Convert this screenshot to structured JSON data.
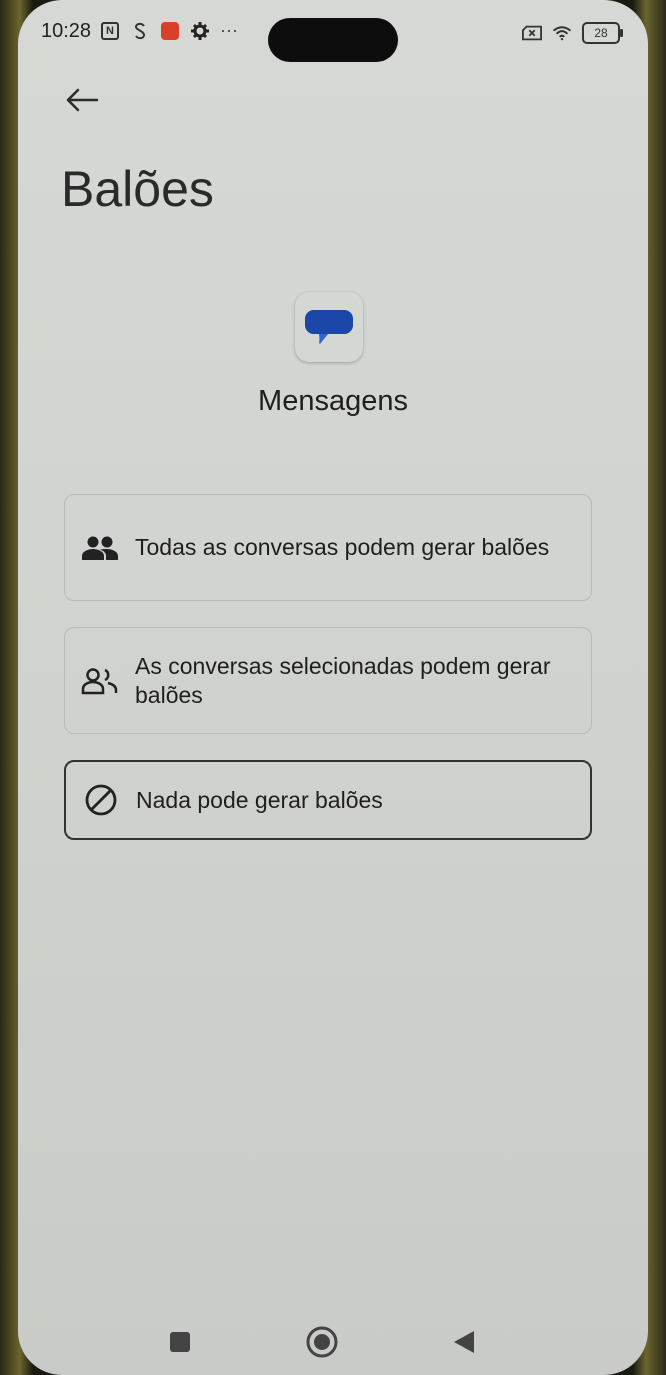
{
  "status_bar": {
    "time": "10:28",
    "battery": "28",
    "more": "···",
    "icons_left": [
      "nfc-icon",
      "sync-icon",
      "mail-app-icon",
      "settings-gear-icon"
    ],
    "icons_right": [
      "no-sim-icon",
      "wifi-icon",
      "battery-icon"
    ]
  },
  "header": {
    "back_icon": "arrow-left-icon",
    "title": "Balões"
  },
  "app": {
    "name": "Mensagens",
    "icon": "messages-app-icon",
    "icon_color": "#1a56c4"
  },
  "options": [
    {
      "label": "Todas as conversas podem gerar balões",
      "icon": "people-filled-icon",
      "selected": false
    },
    {
      "label": "As conversas selecionadas podem gerar balões",
      "icon": "people-outline-icon",
      "selected": false
    },
    {
      "label": "Nada pode gerar balões",
      "icon": "block-icon",
      "selected": true
    }
  ],
  "nav_bar": {
    "items": [
      "recents-square-icon",
      "home-circle-icon",
      "back-triangle-icon"
    ]
  }
}
